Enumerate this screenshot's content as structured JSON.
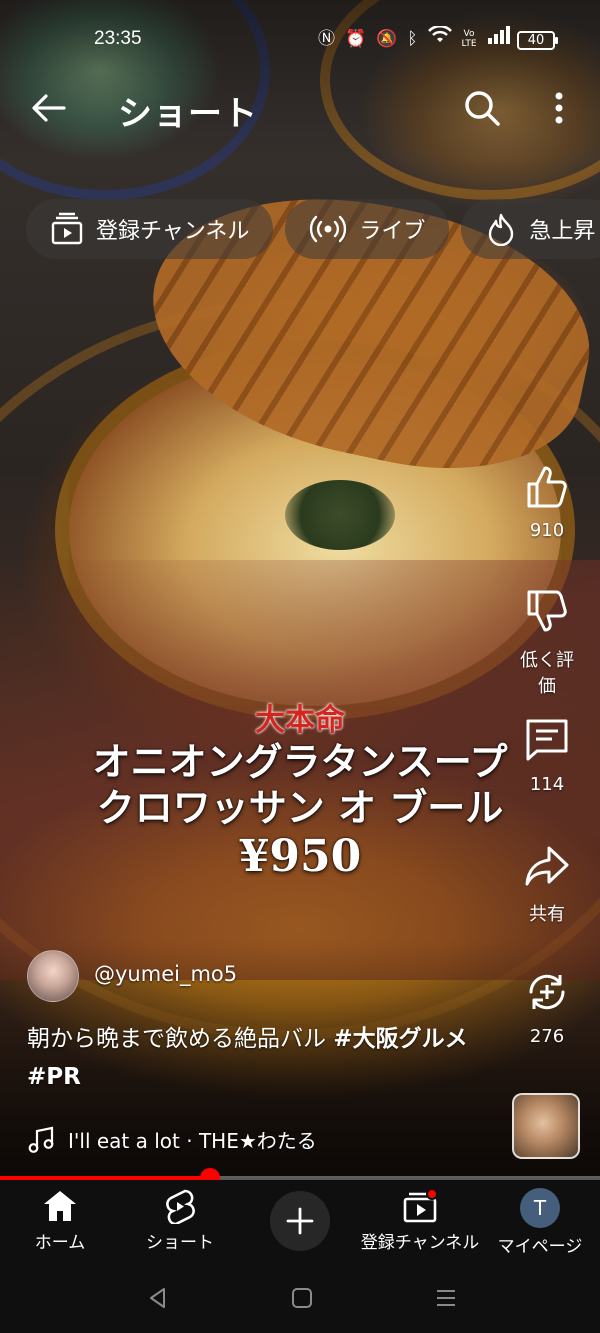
{
  "status_bar": {
    "time": "23:35",
    "icons": [
      "nfc-icon",
      "alarm-icon",
      "mute-icon",
      "bluetooth-icon",
      "wifi-icon",
      "volte-icon",
      "signal-icon"
    ],
    "battery": "40"
  },
  "header": {
    "title": "ショート"
  },
  "chips": [
    {
      "label": "登録チャンネル",
      "icon": "subscriptions-icon"
    },
    {
      "label": "ライブ",
      "icon": "live-icon"
    },
    {
      "label": "急上昇",
      "icon": "trending-icon"
    }
  ],
  "actions": {
    "like_count": "910",
    "dislike_label": "低く評価",
    "comment_count": "114",
    "share_label": "共有",
    "remix_count": "276"
  },
  "overlay": {
    "red_text": "大本命",
    "line1": "オニオングラタンスープ",
    "line2": "クロワッサン オ ブール",
    "price": "¥950"
  },
  "channel": {
    "handle": "@yumei_mo5"
  },
  "caption": {
    "text": "朝から晩まで飲める絶品バル ",
    "tag1": "#大阪グルメ",
    "tag2": "#PR"
  },
  "music": {
    "text": "I'll eat a lot · THE★わたる"
  },
  "progress": {
    "fraction": 0.35
  },
  "bottom_nav": {
    "home": "ホーム",
    "shorts": "ショート",
    "subscriptions": "登録チャンネル",
    "mypage": "マイページ",
    "avatar_letter": "T"
  },
  "colors": {
    "accent_red": "#ff0000",
    "nav_bg": "#0f0f0f",
    "avatar_bg": "#455e7c"
  }
}
